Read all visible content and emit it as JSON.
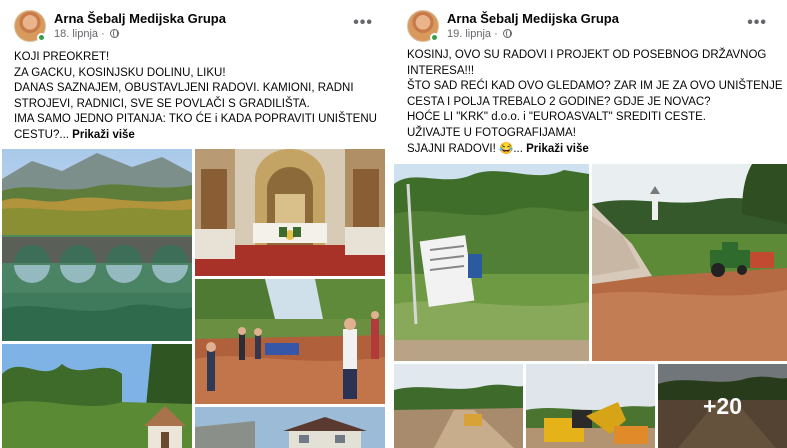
{
  "posts": [
    {
      "author": "Arna Šebalj Medijska Grupa",
      "date": "18. lipnja",
      "menu_glyph": "•••",
      "lines": [
        "KOJI PREOKRET!",
        "ZA GACKU, KOSINJSKU DOLINU, LIKU!",
        "DANAS SAZNAJEM, OBUSTAVLJENI RADOVI. KAMIONI, RADNI",
        "STROJEVI, RADNICI, SVE SE POVLAČI S GRADILIŠTA.",
        "IMA SAMO JEDNO PITANJA: TKO ĆE i KADA POPRAVITI UNIŠTENU",
        "CESTU?..."
      ],
      "see_more": "Prikaži više",
      "photos": [
        "river-bridge-photo",
        "church-interior-photo",
        "people-excavation-photo",
        "chapel-forest-photo",
        "house-photo"
      ]
    },
    {
      "author": "Arna Šebalj Medijska Grupa",
      "date": "19. lipnja",
      "menu_glyph": "•••",
      "lines": [
        "KOSINJ, OVO SU RADOVI I PROJEKT OD POSEBNOG DRŽAVNOG",
        "INTERESA!!!",
        "ŠTO SAD REĆI KAD OVO GLEDAMO? ZAR IM JE ZA OVO UNIŠTENJE",
        "CESTA I POLJA TREBALO 2 GODINE? GDJE JE NOVAC?",
        "HOĆE LI \"KRK\" d.o.o. i \"EUROASVALT\" SREDITI CESTE.",
        "UŽIVAJTE U FOTOGRAFIJAMA!",
        "SJAJNI RADOVI! 😂..."
      ],
      "see_more": "Prikaži više",
      "more_photos": "+20",
      "photos": [
        "construction-sign-photo",
        "tractor-field-photo",
        "road-truck-photo",
        "excavator-photo",
        "dirt-road-photo"
      ]
    }
  ],
  "colors": {
    "online": "#31a24c",
    "meta": "#65676b",
    "text": "#050505"
  }
}
